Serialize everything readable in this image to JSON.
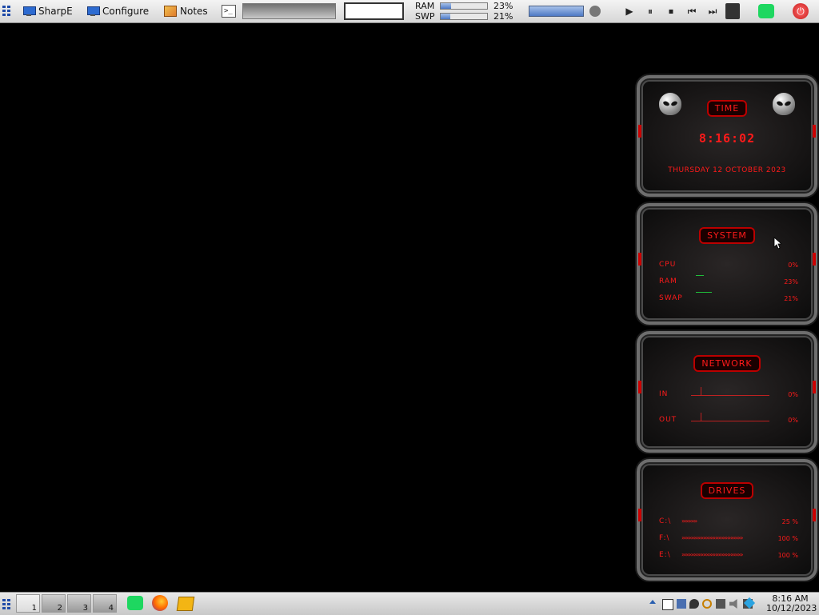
{
  "taskbar_top": {
    "launchers": [
      {
        "label": "SharpE"
      },
      {
        "label": "Configure"
      },
      {
        "label": "Notes"
      }
    ],
    "terminal_glyph": ">_",
    "input_value": "",
    "meters": {
      "ram": {
        "label": "RAM",
        "value": "23%",
        "level": 0.23
      },
      "swp": {
        "label": "SWP",
        "value": "21%",
        "level": 0.21
      }
    },
    "volume_level": 1.0,
    "media": {
      "play": "▶",
      "pause": "⏸",
      "stop": "⏹",
      "prev": "⏮",
      "next": "⏭"
    },
    "power_glyph": "⏻"
  },
  "taskbar_bottom": {
    "workspaces": [
      {
        "label": "1",
        "active": true
      },
      {
        "label": "2",
        "active": false
      },
      {
        "label": "3",
        "active": false
      },
      {
        "label": "4",
        "active": false
      }
    ],
    "clock": {
      "time": "8:16 AM",
      "date": "10/12/2023"
    }
  },
  "widgets": {
    "time": {
      "title": "TIME",
      "clock": "8:16:02",
      "date": "THURSDAY 12 OCTOBER 2023"
    },
    "system": {
      "title": "SYSTEM",
      "rows": [
        {
          "label": "CPU",
          "value": "0%"
        },
        {
          "label": "RAM",
          "value": "23%"
        },
        {
          "label": "SWAP",
          "value": "21%"
        }
      ]
    },
    "network": {
      "title": "NETWORK",
      "rows": [
        {
          "label": "IN",
          "value": "0%"
        },
        {
          "label": "OUT",
          "value": "0%"
        }
      ]
    },
    "drives": {
      "title": "DRIVES",
      "rows": [
        {
          "label": "C:\\",
          "value": "25 %",
          "level": 0.25
        },
        {
          "label": "F:\\",
          "value": "100 %",
          "level": 1.0
        },
        {
          "label": "E:\\",
          "value": "100 %",
          "level": 1.0
        }
      ]
    }
  },
  "colors": {
    "accent_red": "#ff1a1a",
    "desktop_bg": "#000000",
    "bar_blue": "#4d78c4"
  }
}
